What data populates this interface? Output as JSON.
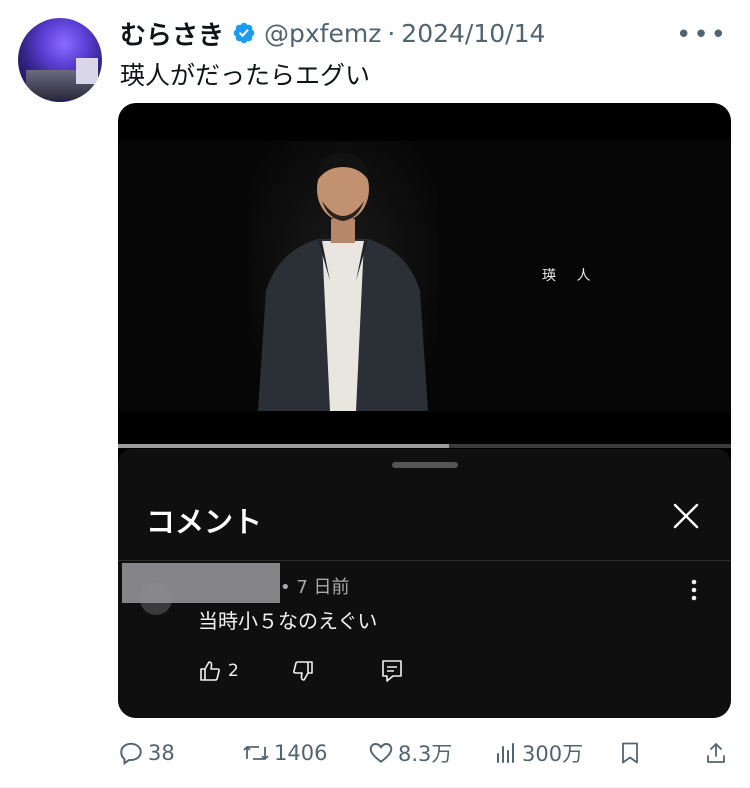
{
  "author": {
    "display_name": "むらさき",
    "handle": "@pxfemz",
    "separator": "·",
    "date": "2024/10/14"
  },
  "tweet": {
    "text": "瑛人がだったらエグい"
  },
  "video": {
    "caption": "瑛 人",
    "progress_fraction": 0.54
  },
  "comments_sheet": {
    "title": "コメント",
    "comment": {
      "meta": "• 7 日前",
      "text": "当時小５なのえぐい",
      "like_count": "2"
    }
  },
  "actions": {
    "replies": "38",
    "reposts": "1406",
    "likes": "8.3万",
    "views": "300万"
  },
  "colors": {
    "verified": "#1d9bf0",
    "secondary_text": "#536471",
    "sheet_bg": "#0f0f0f"
  }
}
